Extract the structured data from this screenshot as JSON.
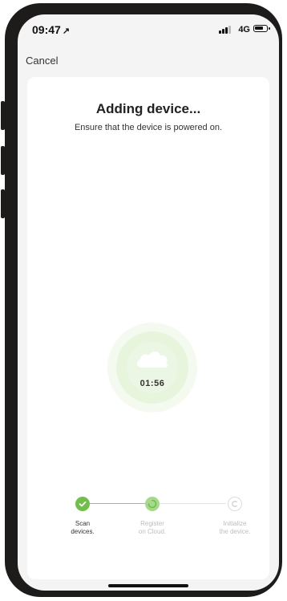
{
  "status_bar": {
    "time": "09:47",
    "location_glyph": "↗",
    "network": "4G",
    "icons": [
      "signal-icon",
      "battery-icon"
    ]
  },
  "nav": {
    "cancel_label": "Cancel"
  },
  "header": {
    "title": "Adding device...",
    "subtitle": "Ensure that the device is powered on."
  },
  "progress": {
    "icon": "cloud-icon",
    "countdown": "01:56"
  },
  "steps": [
    {
      "label_line1": "Scan",
      "label_line2": "devices.",
      "state": "done",
      "icon": "check-icon"
    },
    {
      "label_line1": "Register",
      "label_line2": "on Cloud.",
      "state": "active",
      "icon": "spinner-icon"
    },
    {
      "label_line1": "Initialize",
      "label_line2": "the device.",
      "state": "pending",
      "icon": "c-circle-icon"
    }
  ],
  "colors": {
    "accent": "#6fbf4a",
    "accent_light": "#a7d98c",
    "pending": "#d4d4d4",
    "text_primary": "#333333",
    "text_muted": "#bdbdbd"
  }
}
